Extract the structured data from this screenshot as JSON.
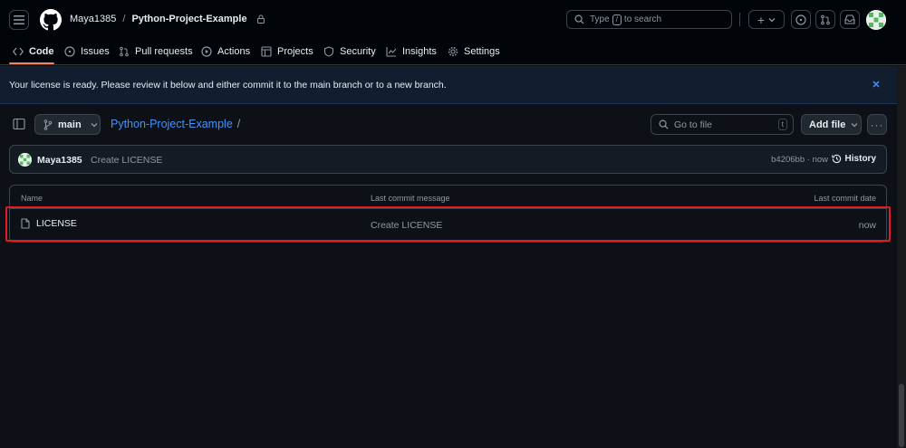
{
  "header": {
    "owner": "Maya1385",
    "separator": "/",
    "repo_name": "Python-Project-Example",
    "search_placeholder_before": "Type",
    "search_key": "/",
    "search_placeholder_after": "to search",
    "plus_label": "+"
  },
  "tabs": [
    {
      "label": "Code",
      "icon": "code-icon",
      "active": true
    },
    {
      "label": "Issues",
      "icon": "issue-icon"
    },
    {
      "label": "Pull requests",
      "icon": "pull-request-icon"
    },
    {
      "label": "Actions",
      "icon": "play-icon"
    },
    {
      "label": "Projects",
      "icon": "table-icon"
    },
    {
      "label": "Security",
      "icon": "shield-icon"
    },
    {
      "label": "Insights",
      "icon": "graph-icon"
    },
    {
      "label": "Settings",
      "icon": "gear-icon"
    }
  ],
  "flash": {
    "message": "Your license is ready. Please review it below and either commit it to the main branch or to a new branch."
  },
  "repo_bar": {
    "branch": "main",
    "path_repo": "Python-Project-Example",
    "path_sep": "/",
    "go_to_file": "Go to file",
    "go_to_file_key": "t",
    "add_file": "Add file",
    "more": "···"
  },
  "commit": {
    "author": "Maya1385",
    "message": "Create LICENSE",
    "sha_time": "b4206bb · now",
    "history": "History"
  },
  "file_table": {
    "headers": {
      "name": "Name",
      "message": "Last commit message",
      "date": "Last commit date"
    },
    "rows": [
      {
        "name": "LICENSE",
        "message": "Create LICENSE",
        "date": "now"
      }
    ]
  },
  "colors": {
    "background": "#0d1117",
    "header": "#010409",
    "accent_link": "#4493f8",
    "tab_underline": "#f78166",
    "highlight_box": "#e01b24"
  }
}
